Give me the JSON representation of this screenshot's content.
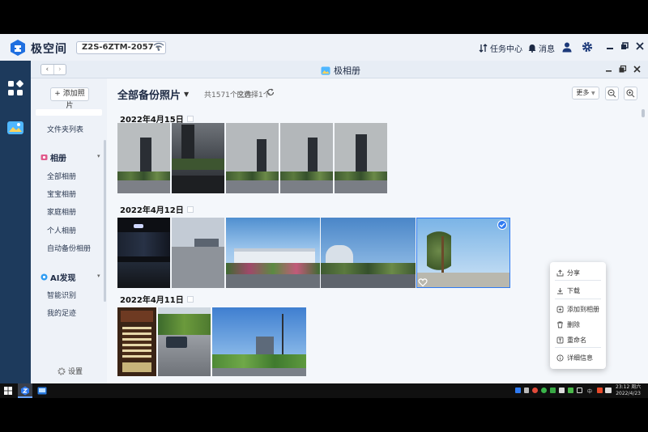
{
  "topbar": {
    "logo_text": "极空间",
    "device_name": "Z2S-6ZTM-2057",
    "task_center": "任务中心",
    "messages": "消息"
  },
  "window": {
    "title": "极相册"
  },
  "sidebar": {
    "add_photo": "+ 添加照片",
    "items_top": [
      {
        "label": "文件夹列表"
      }
    ],
    "albums_group": "相册",
    "albums": [
      {
        "label": "全部相册"
      },
      {
        "label": "宝宝相册"
      },
      {
        "label": "家庭相册"
      },
      {
        "label": "个人相册"
      },
      {
        "label": "自动备份相册"
      }
    ],
    "ai_group": "AI发现",
    "ai_items": [
      {
        "label": "智能识别"
      },
      {
        "label": "我的足迹"
      }
    ],
    "settings": "设置"
  },
  "main": {
    "title": "全部备份照片",
    "file_count": "共1571个文件",
    "selected_count": "已选择1个",
    "more_label": "更多"
  },
  "sections": [
    {
      "date": "2022年4月15日"
    },
    {
      "date": "2022年4月12日"
    },
    {
      "date": "2022年4月11日"
    }
  ],
  "context_menu": {
    "items": [
      {
        "label": "分享"
      },
      {
        "label": "下载"
      },
      {
        "label": "添加到相册"
      },
      {
        "label": "删除"
      },
      {
        "label": "重命名"
      },
      {
        "label": "详细信息"
      }
    ]
  },
  "taskbar": {
    "ime_label": "中",
    "time": "23:12 周六",
    "date": "2022/4/23"
  },
  "colors": {
    "accent": "#2f7bf2",
    "dock": "#1d3a5c"
  }
}
